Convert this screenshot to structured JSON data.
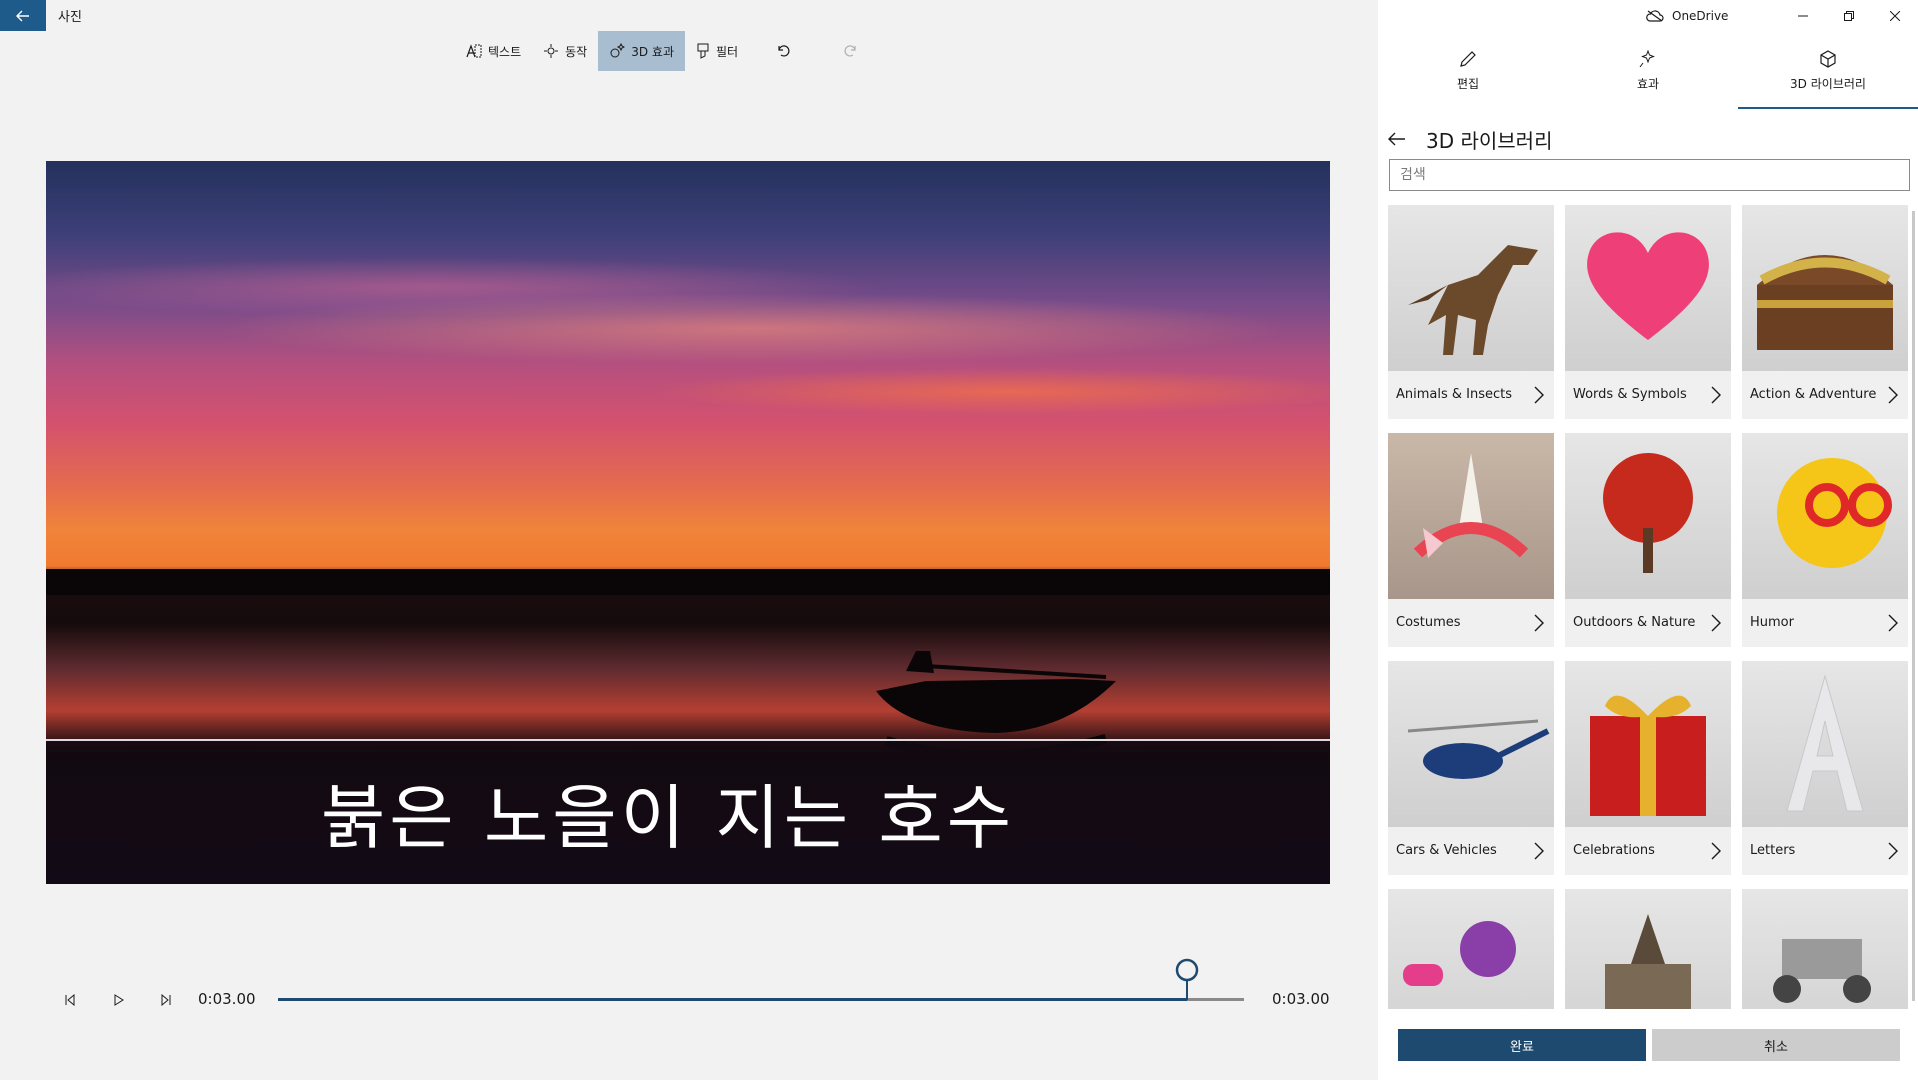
{
  "app": {
    "title": "사진"
  },
  "titlebar": {
    "onedrive_label": "OneDrive"
  },
  "toolbar": {
    "text_label": "텍스트",
    "motion_label": "동작",
    "effects3d_label": "3D 효과",
    "filter_label": "필터"
  },
  "preview": {
    "caption": "붉은 노을이 지는 호수"
  },
  "playback": {
    "current_time": "0:03.00",
    "end_time": "0:03.00",
    "progress": 0.94
  },
  "panel": {
    "tabs": [
      {
        "label": "편집"
      },
      {
        "label": "효과"
      },
      {
        "label": "3D 라이브러리"
      }
    ],
    "header_title": "3D 라이브러리",
    "search_placeholder": "검색",
    "categories": [
      {
        "label": "Animals & Insects",
        "icon": "dinosaur-icon"
      },
      {
        "label": "Words & Symbols",
        "icon": "heart-icon"
      },
      {
        "label": "Action & Adventure",
        "icon": "treasure-chest-icon"
      },
      {
        "label": "Costumes",
        "icon": "unicorn-headband-icon"
      },
      {
        "label": "Outdoors & Nature",
        "icon": "tree-icon"
      },
      {
        "label": "Humor",
        "icon": "emoji-glasses-icon"
      },
      {
        "label": "Cars & Vehicles",
        "icon": "helicopter-icon"
      },
      {
        "label": "Celebrations",
        "icon": "gift-icon"
      },
      {
        "label": "Letters",
        "icon": "letter-a-icon"
      },
      {
        "label": "",
        "icon": "robot-icon"
      },
      {
        "label": "",
        "icon": "castle-icon"
      },
      {
        "label": "",
        "icon": "rover-icon"
      }
    ],
    "done_label": "완료",
    "cancel_label": "취소"
  },
  "colors": {
    "accent": "#1e5a8a",
    "primary_button": "#1e4a70",
    "active_tool": "#a9bdd0"
  }
}
